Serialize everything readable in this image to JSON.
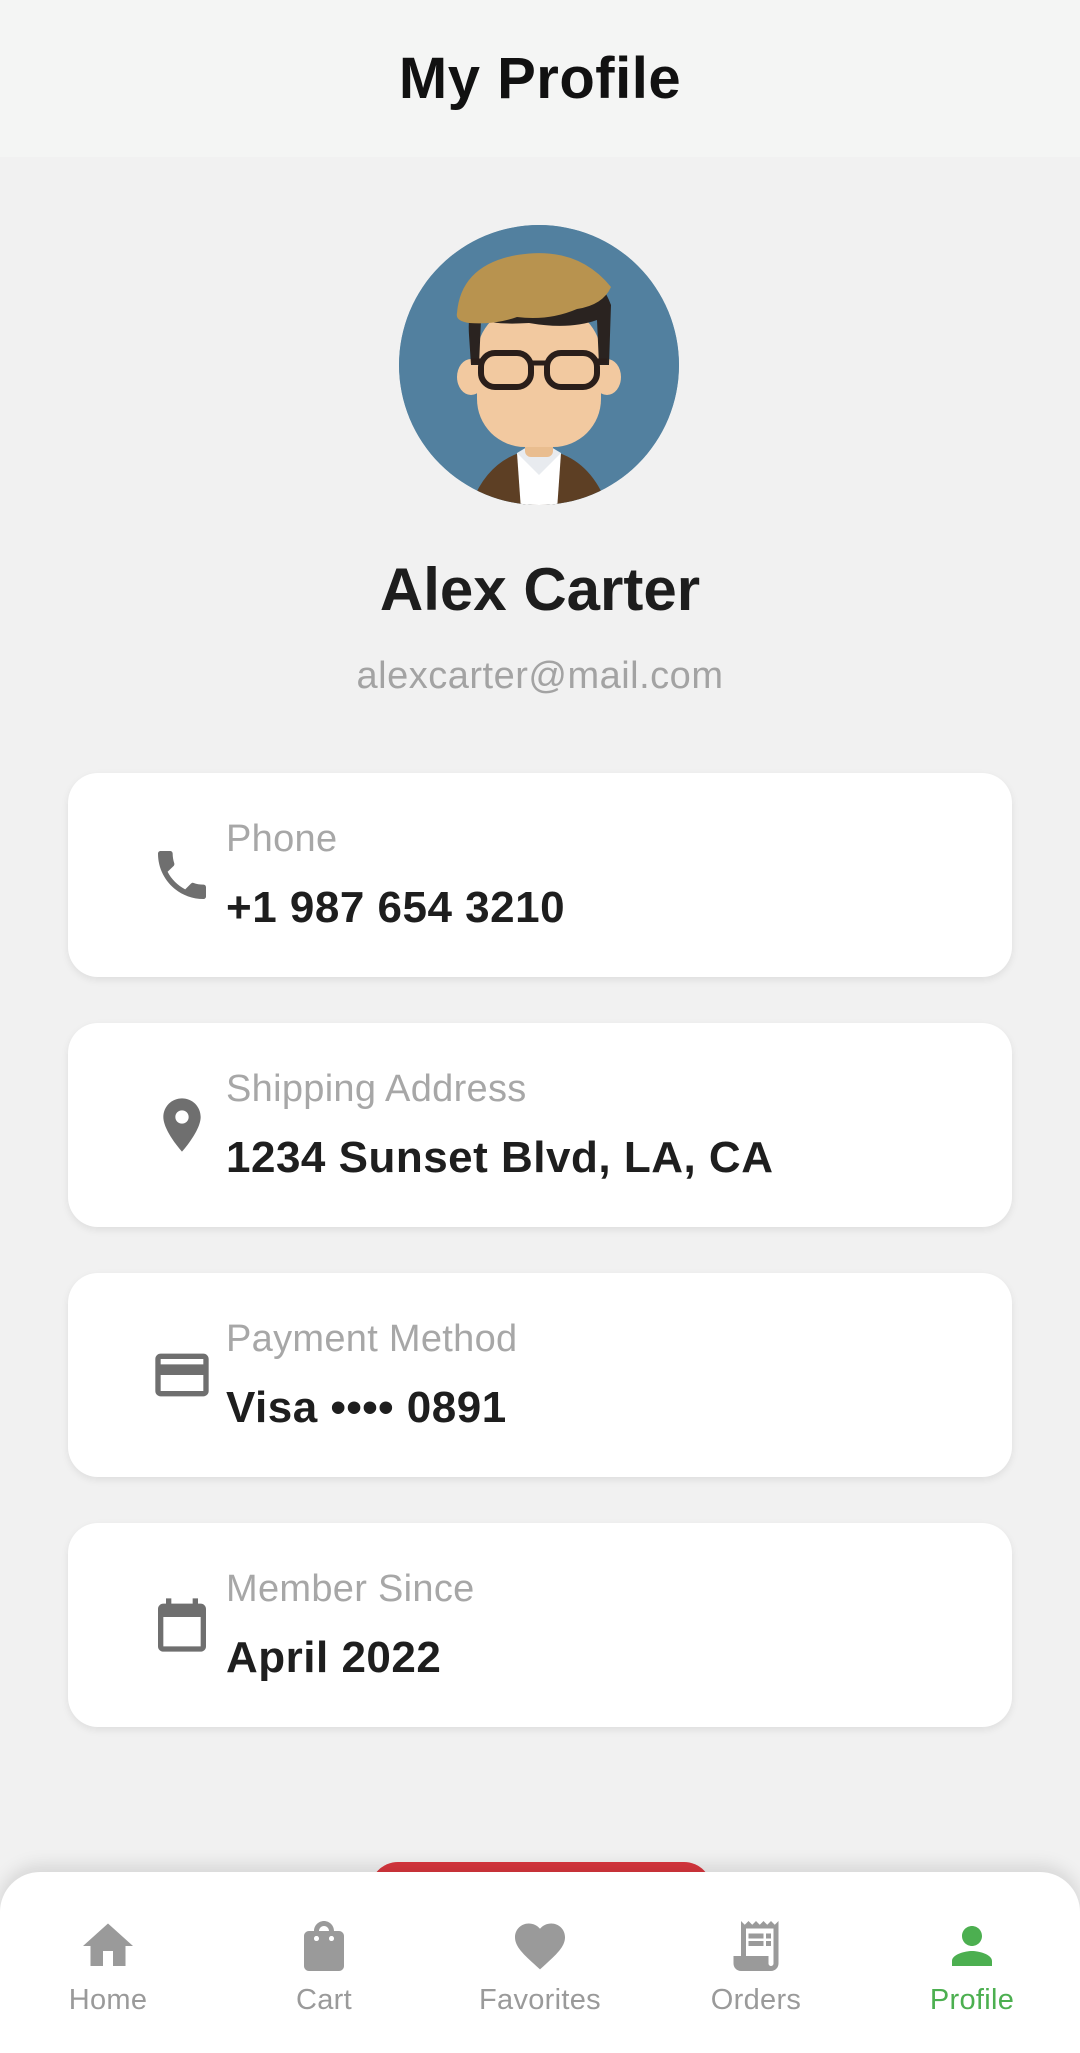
{
  "header": {
    "title": "My Profile"
  },
  "profile": {
    "name": "Alex Carter",
    "email": "alexcarter@mail.com",
    "avatar_icon": "avatar-illustration"
  },
  "info_cards": [
    {
      "icon": "phone-icon",
      "label": "Phone",
      "value": "+1 987 654 3210"
    },
    {
      "icon": "location-pin-icon",
      "label": "Shipping Address",
      "value": "1234 Sunset Blvd, LA, CA"
    },
    {
      "icon": "credit-card-icon",
      "label": "Payment Method",
      "value": "Visa •••• 0891"
    },
    {
      "icon": "calendar-icon",
      "label": "Member Since",
      "value": "April 2022"
    }
  ],
  "bottom_nav": {
    "items": [
      {
        "label": "Home",
        "icon": "home-icon",
        "active": false
      },
      {
        "label": "Cart",
        "icon": "shopping-bag-icon",
        "active": false
      },
      {
        "label": "Favorites",
        "icon": "heart-icon",
        "active": false
      },
      {
        "label": "Orders",
        "icon": "receipt-icon",
        "active": false
      },
      {
        "label": "Profile",
        "icon": "person-icon",
        "active": true
      }
    ]
  },
  "colors": {
    "accent": "#4caf50",
    "inactive": "#9a9a9a",
    "logout": "#d9363e",
    "background": "#f1f1f1",
    "card": "#ffffff",
    "icon": "#6f6f6f"
  }
}
